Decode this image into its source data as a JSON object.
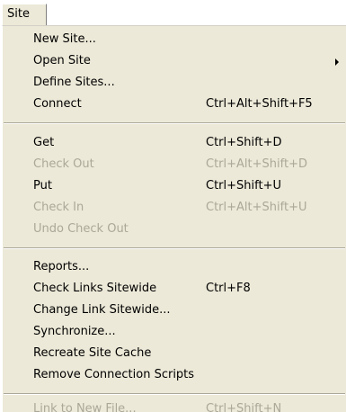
{
  "menubar": {
    "title": "Site"
  },
  "menu": {
    "group1": [
      {
        "label": "New Site...",
        "shortcut": "",
        "enabled": true
      },
      {
        "label": "Open Site",
        "shortcut": "",
        "enabled": true,
        "submenu": true
      },
      {
        "label": "Define Sites...",
        "shortcut": "",
        "enabled": true
      },
      {
        "label": "Connect",
        "shortcut": "Ctrl+Alt+Shift+F5",
        "enabled": true
      }
    ],
    "group2": [
      {
        "label": "Get",
        "shortcut": "Ctrl+Shift+D",
        "enabled": true
      },
      {
        "label": "Check Out",
        "shortcut": "Ctrl+Alt+Shift+D",
        "enabled": false
      },
      {
        "label": "Put",
        "shortcut": "Ctrl+Shift+U",
        "enabled": true
      },
      {
        "label": "Check In",
        "shortcut": "Ctrl+Alt+Shift+U",
        "enabled": false
      },
      {
        "label": "Undo Check Out",
        "shortcut": "",
        "enabled": false
      }
    ],
    "group3": [
      {
        "label": "Reports...",
        "shortcut": "",
        "enabled": true
      },
      {
        "label": "Check Links Sitewide",
        "shortcut": "Ctrl+F8",
        "enabled": true
      },
      {
        "label": "Change Link Sitewide...",
        "shortcut": "",
        "enabled": true
      },
      {
        "label": "Synchronize...",
        "shortcut": "",
        "enabled": true
      },
      {
        "label": "Recreate Site Cache",
        "shortcut": "",
        "enabled": true
      },
      {
        "label": "Remove Connection Scripts",
        "shortcut": "",
        "enabled": true
      }
    ],
    "group4": [
      {
        "label": "Link to New File...",
        "shortcut": "Ctrl+Shift+N",
        "enabled": false
      }
    ]
  },
  "colors": {
    "menu_bg": "#ece9d8",
    "disabled_text": "#aca899",
    "enabled_text": "#000000"
  },
  "icons": {
    "submenu_indicator": "chevron-right-icon"
  }
}
